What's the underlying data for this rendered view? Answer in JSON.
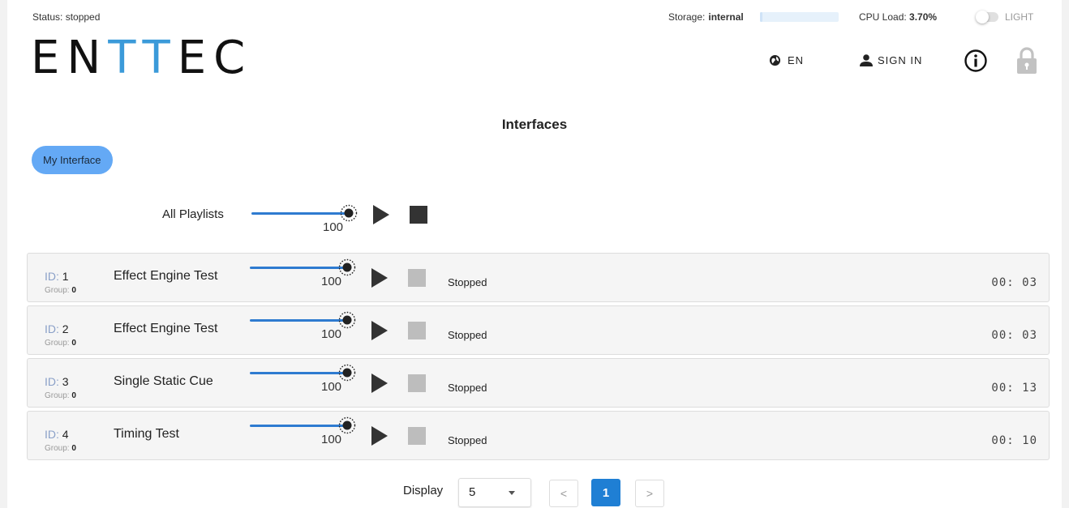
{
  "status": {
    "label": "Status:",
    "value": "stopped"
  },
  "storage": {
    "label": "Storage:",
    "value": "internal",
    "used_fraction": 0.03
  },
  "cpu": {
    "label": "CPU Load:",
    "value": "3.70%"
  },
  "theme": {
    "label": "LIGHT"
  },
  "logo": {
    "part1": "EN",
    "part2": "TT",
    "part3": "EC"
  },
  "header": {
    "language": "EN",
    "sign_in": "SIGN IN"
  },
  "page_title": "Interfaces",
  "interface_tab": "My Interface",
  "all_playlists": {
    "label": "All Playlists",
    "level": "100"
  },
  "playlists": [
    {
      "id_label": "ID:",
      "id": "1",
      "group_label": "Group:",
      "group": "0",
      "name": "Effect Engine Test",
      "level": "100",
      "status": "Stopped",
      "time": "00: 03"
    },
    {
      "id_label": "ID:",
      "id": "2",
      "group_label": "Group:",
      "group": "0",
      "name": "Effect Engine Test",
      "level": "100",
      "status": "Stopped",
      "time": "00: 03"
    },
    {
      "id_label": "ID:",
      "id": "3",
      "group_label": "Group:",
      "group": "0",
      "name": "Single Static Cue",
      "level": "100",
      "status": "Stopped",
      "time": "00: 13"
    },
    {
      "id_label": "ID:",
      "id": "4",
      "group_label": "Group:",
      "group": "0",
      "name": "Timing Test",
      "level": "100",
      "status": "Stopped",
      "time": "00: 10"
    }
  ],
  "pagination": {
    "display_label": "Display",
    "page_size": "5",
    "prev": "<",
    "current_page": "1",
    "next": ">"
  },
  "colors": {
    "brand_blue": "#3b9ad9",
    "accent": "#1f7fd4",
    "tab": "#64a9f5",
    "slider": "#2e7bd0"
  },
  "icons": [
    "globe-icon",
    "user-icon",
    "info-icon",
    "lock-icon",
    "brightness-icon",
    "play-icon",
    "stop-icon",
    "chevron-down-icon"
  ]
}
